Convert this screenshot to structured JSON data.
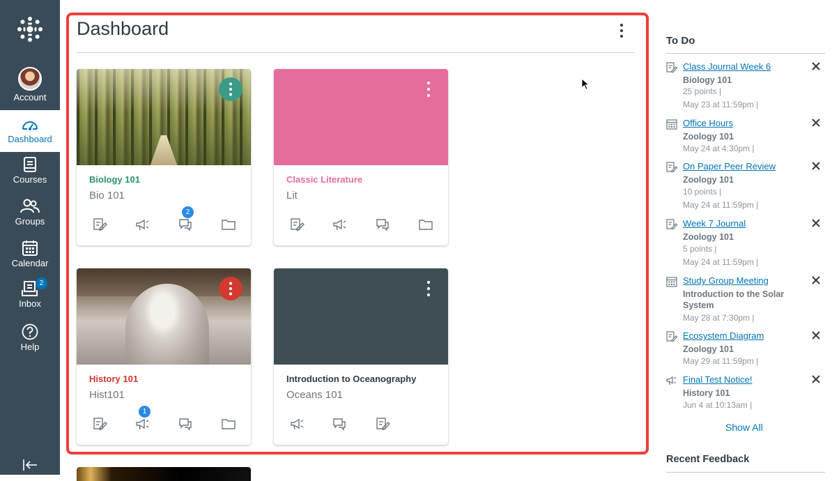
{
  "nav": {
    "account_label": "Account",
    "dashboard_label": "Dashboard",
    "courses_label": "Courses",
    "groups_label": "Groups",
    "calendar_label": "Calendar",
    "inbox_label": "Inbox",
    "inbox_badge": "2",
    "help_label": "Help"
  },
  "dashboard": {
    "title": "Dashboard"
  },
  "cards": [
    {
      "title": "Biology 101",
      "code": "Bio 101",
      "color": "#2a8f6f",
      "menu_color": "#3a9b87",
      "discussion_badge": "2"
    },
    {
      "title": "Classic Literature",
      "code": "Lit",
      "color": "#e56d9c"
    },
    {
      "title": "History 101",
      "code": "Hist101",
      "color": "#d0342c",
      "menu_color": "#d33a2e",
      "announcement_badge": "1"
    },
    {
      "title": "Introduction to Oceanography",
      "code": "Oceans 101",
      "color": "#2d3b45",
      "hero_color": "#3e4e52"
    }
  ],
  "todo": {
    "title": "To Do",
    "items": [
      {
        "icon": "assignment-icon",
        "link": "Class Journal Week 6",
        "course": "Biology 101",
        "points": "25 points  |",
        "date": "May 23 at 11:59pm  |"
      },
      {
        "icon": "calendar-event-icon",
        "link": "Office Hours",
        "course": "Zoology 101",
        "date": "May 24 at 4:30pm  |"
      },
      {
        "icon": "assignment-icon",
        "link": "On Paper Peer Review",
        "course": "Zoology 101",
        "points": "10 points  |",
        "date": "May 24 at 11:59pm  |"
      },
      {
        "icon": "assignment-icon",
        "link": "Week 7 Journal",
        "course": "Zoology 101",
        "points": "5 points  |",
        "date": "May 24 at 11:59pm  |"
      },
      {
        "icon": "calendar-event-icon",
        "link": "Study Group Meeting",
        "course": "Introduction to the Solar System",
        "date": "May 28 at 7:30pm  |"
      },
      {
        "icon": "assignment-icon",
        "link": "Ecosystem Diagram",
        "course": "Zoology 101",
        "date": "May 29 at 11:59pm  |"
      },
      {
        "icon": "announcement-icon",
        "link": "Final Test Notice!",
        "course": "History 101",
        "date": "Jun 4 at 10:13am  |"
      }
    ],
    "show_all": "Show All"
  },
  "recent_feedback": {
    "title": "Recent Feedback"
  },
  "colors": {
    "nav_bg": "#394b58",
    "accent": "#0374b5",
    "highlight": "#ee3e3e"
  }
}
